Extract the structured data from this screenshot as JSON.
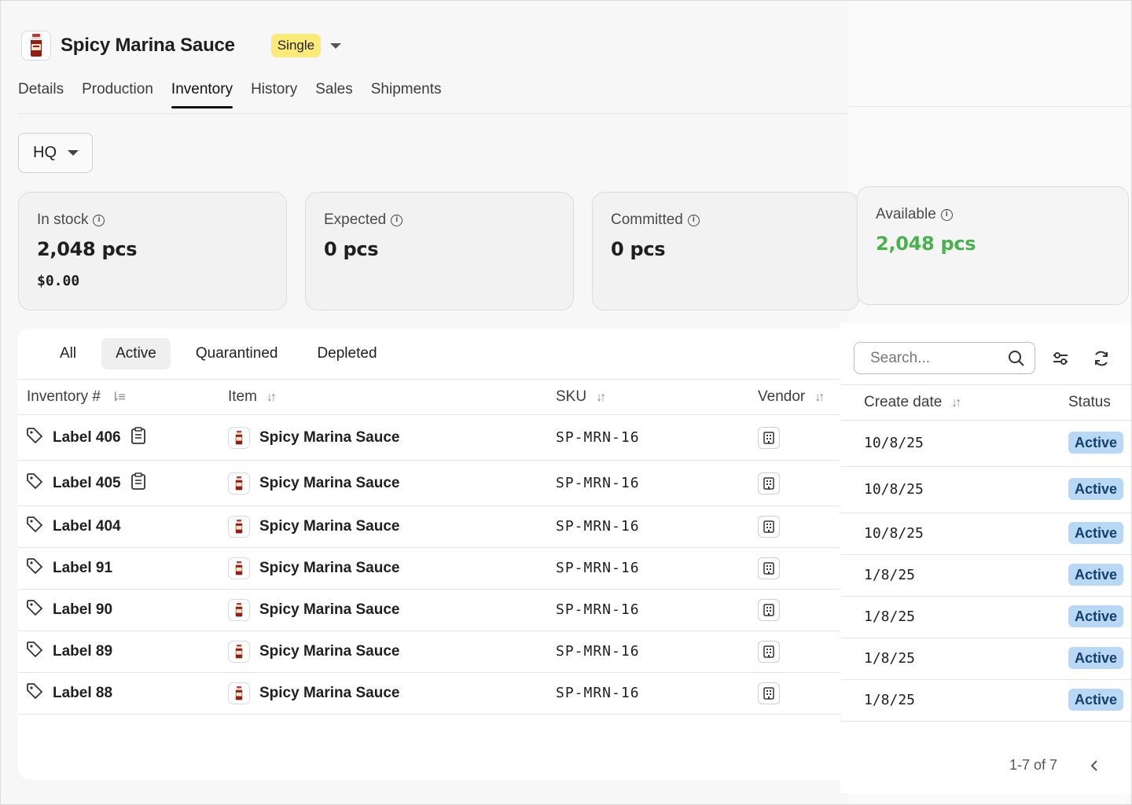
{
  "product": {
    "title": "Spicy Marina Sauce",
    "variant_badge": "Single",
    "thumb_icon": "sauce-jar-icon"
  },
  "tabs": [
    "Details",
    "Production",
    "Inventory",
    "History",
    "Sales",
    "Shipments"
  ],
  "active_tab": "Inventory",
  "location": {
    "value": "HQ"
  },
  "stats": {
    "in_stock": {
      "label": "In stock",
      "value": "2,048 pcs",
      "money": "$0.00"
    },
    "expected": {
      "label": "Expected",
      "value": "0 pcs"
    },
    "committed": {
      "label": "Committed",
      "value": "0 pcs"
    },
    "available": {
      "label": "Available",
      "value": "2,048 pcs",
      "color": "#4caf50"
    }
  },
  "filters": [
    "All",
    "Active",
    "Quarantined",
    "Depleted"
  ],
  "active_filter": "Active",
  "search": {
    "placeholder": "Search..."
  },
  "table": {
    "columns": [
      "Inventory #",
      "Item",
      "SKU",
      "Vendor"
    ],
    "side_columns": [
      "Create date",
      "Status"
    ],
    "rows": [
      {
        "label": "Label 406",
        "item": "Spicy Marina Sauce",
        "sku": "SP-MRN-16",
        "date": "10/8/25",
        "status": "Active"
      },
      {
        "label": "Label 405",
        "item": "Spicy Marina Sauce",
        "sku": "SP-MRN-16",
        "date": "10/8/25",
        "status": "Active"
      },
      {
        "label": "Label 404",
        "item": "Spicy Marina Sauce",
        "sku": "SP-MRN-16",
        "date": "10/8/25",
        "status": "Active"
      },
      {
        "label": "Label 91",
        "item": "Spicy Marina Sauce",
        "sku": "SP-MRN-16",
        "date": "1/8/25",
        "status": "Active"
      },
      {
        "label": "Label 90",
        "item": "Spicy Marina Sauce",
        "sku": "SP-MRN-16",
        "date": "1/8/25",
        "status": "Active"
      },
      {
        "label": "Label 89",
        "item": "Spicy Marina Sauce",
        "sku": "SP-MRN-16",
        "date": "1/8/25",
        "status": "Active"
      },
      {
        "label": "Label 88",
        "item": "Spicy Marina Sauce",
        "sku": "SP-MRN-16",
        "date": "1/8/25",
        "status": "Active"
      }
    ]
  },
  "pagination": {
    "text": "1-7 of 7"
  },
  "colors": {
    "status_badge_bg": "#b9d8f5",
    "variant_badge_bg": "#fbe97a"
  }
}
